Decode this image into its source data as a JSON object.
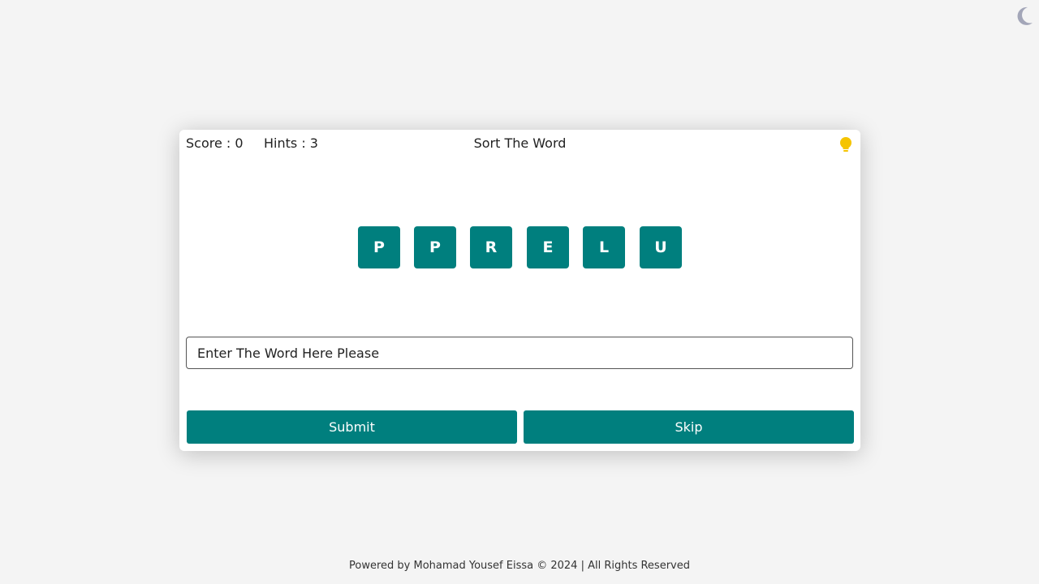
{
  "header": {
    "score_label": "Score : 0",
    "hints_label": "Hints : 3",
    "title": "Sort The Word",
    "hint_icon": "lightbulb-icon"
  },
  "theme_toggle_icon": "moon-icon",
  "tiles": [
    "P",
    "P",
    "R",
    "E",
    "L",
    "U"
  ],
  "answer": {
    "placeholder": "Enter The Word Here Please",
    "value": ""
  },
  "actions": {
    "submit_label": "Submit",
    "skip_label": "Skip"
  },
  "footer": {
    "text": "Powered by Mohamad Yousef Eissa © 2024 | All Rights Reserved"
  },
  "colors": {
    "accent": "#007f7e",
    "background": "#f4f4f4",
    "hint_icon": "#f5c400",
    "moon_icon": "#a3a6b8"
  }
}
